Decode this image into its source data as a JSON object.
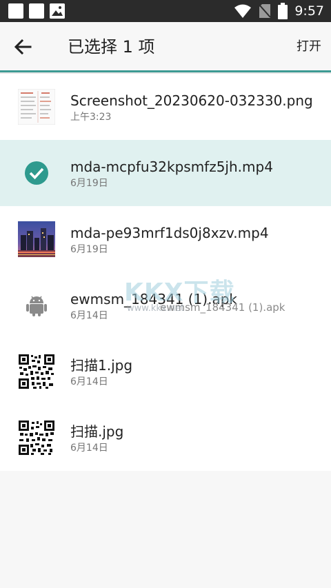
{
  "status_bar": {
    "time": "9:57",
    "icons": [
      "notification-square-icon",
      "notification-square-icon",
      "image-icon",
      "wifi-icon",
      "no-sim-icon",
      "battery-icon"
    ]
  },
  "app_bar": {
    "title": "已选择 1 项",
    "open_label": "打开",
    "accent_color": "#3d9a93"
  },
  "files": [
    {
      "name": "Screenshot_20230620-032330.png",
      "date": "上午3:23",
      "thumb": "screenshot-thumbnail",
      "selected": false
    },
    {
      "name": "mda-mcpfu32kpsmfz5jh.mp4",
      "date": "6月19日",
      "thumb": "check-circle-icon",
      "selected": true
    },
    {
      "name": "mda-pe93mrf1ds0j8xzv.mp4",
      "date": "6月19日",
      "thumb": "city-night-thumbnail",
      "selected": false
    },
    {
      "name": "ewmsm_184341 (1).apk",
      "date": "6月14日",
      "thumb": "android-icon",
      "selected": false,
      "tooltip": "ewmsm_184341 (1).apk"
    },
    {
      "name": "扫描1.jpg",
      "date": "6月14日",
      "thumb": "qr-code-thumbnail",
      "selected": false
    },
    {
      "name": "扫描.jpg",
      "date": "6月14日",
      "thumb": "qr-code-thumbnail",
      "selected": false
    }
  ],
  "watermark": {
    "big": "KKX下载",
    "small": "www.kkx.net"
  }
}
